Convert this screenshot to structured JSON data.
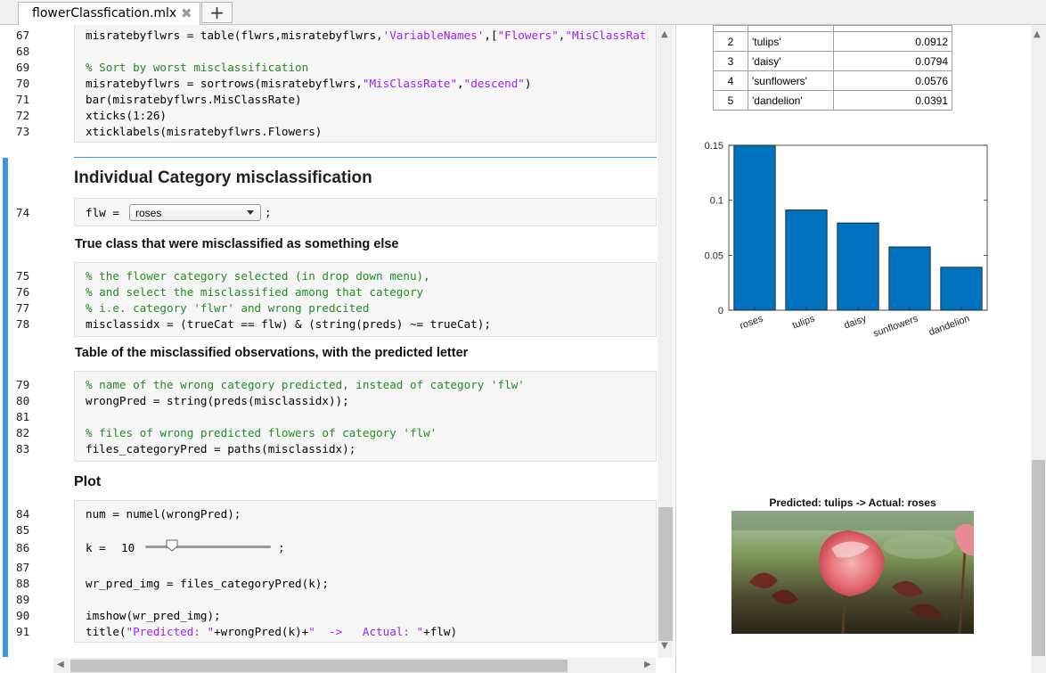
{
  "tabs": {
    "file_label": "flowerClassfication.mlx",
    "close_glyph": "✖",
    "add_glyph": "+"
  },
  "code1": {
    "lines": [
      {
        "n": "67",
        "t": "misratebyflwrs = table(flwrs,misratebyflwrs,'VariableNames',[\"Flowers\",\"MisClassRat"
      },
      {
        "n": "68",
        "t": ""
      },
      {
        "n": "69",
        "t": "% Sort by worst misclassification"
      },
      {
        "n": "70",
        "t": "misratebyflwrs = sortrows(misratebyflwrs,\"MisClassRate\",\"descend\")"
      },
      {
        "n": "71",
        "t": "bar(misratebyflwrs.MisClassRate)"
      },
      {
        "n": "72",
        "t": "xticks(1:26)"
      },
      {
        "n": "73",
        "t": "xticklabels(misratebyflwrs.Flowers)"
      }
    ]
  },
  "section1": {
    "heading": "Individual Category misclassification"
  },
  "line74": {
    "n": "74",
    "prefix": "flw = ",
    "dropdown_value": "roses",
    "suffix": ";"
  },
  "text1": "True class that were misclassified as something else",
  "code2": {
    "c1": "% the flower category selected (in drop down menu),",
    "c2": "% and select the misclassified among that category",
    "c3": "% i.e. category 'flwr' and wrong predcited",
    "c4": "misclassidx = (trueCat == flw) & (string(preds) ~= trueCat);",
    "n": [
      "75",
      "76",
      "77",
      "78"
    ]
  },
  "text2": "Table of the misclassified observations, with the predicted letter",
  "code3": {
    "c1": "% name of the wrong category predicted, instead of category 'flw'",
    "c2": "wrongPred = string(preds(misclassidx));",
    "c4": "% files of wrong predicted flowers of category 'flw'",
    "c5": "files_categoryPred = paths(misclassidx);",
    "n": [
      "79",
      "80",
      "81",
      "82",
      "83"
    ]
  },
  "section2": {
    "heading": "Plot"
  },
  "code4": {
    "c1": "num = numel(wrongPred);",
    "k_label": "k = ",
    "k_value": "10",
    "k_suffix": ";",
    "slider_fraction": 0.21,
    "c5": "wr_pred_img = files_categoryPred(k);",
    "c7": "imshow(wr_pred_img);",
    "c8a": "title(",
    "c8b": "\"Predicted: \"",
    "c8c": "+wrongPred(k)+",
    "c8d": "\"  ->   Actual: \"",
    "c8e": "+flw)",
    "n": [
      "84",
      "85",
      "86",
      "87",
      "88",
      "89",
      "90",
      "91"
    ]
  },
  "output_table": {
    "rows": [
      {
        "idx": "2",
        "name": "'tulips'",
        "val": "0.0912"
      },
      {
        "idx": "3",
        "name": "'daisy'",
        "val": "0.0794"
      },
      {
        "idx": "4",
        "name": "'sunflowers'",
        "val": "0.0576"
      },
      {
        "idx": "5",
        "name": "'dandelion'",
        "val": "0.0391"
      }
    ]
  },
  "chart_data": {
    "type": "bar",
    "categories": [
      "roses",
      "tulips",
      "daisy",
      "sunflowers",
      "dandelion"
    ],
    "values": [
      0.155,
      0.0912,
      0.0794,
      0.0576,
      0.0391
    ],
    "ylim": [
      0,
      0.15
    ],
    "yticks": [
      0,
      0.05,
      0.1,
      0.15
    ],
    "ytick_labels": [
      "0",
      "0.05",
      "0.1",
      "0.15"
    ],
    "bar_color": "#0072bd",
    "title": "",
    "xlabel": "",
    "ylabel": ""
  },
  "image_output": {
    "title": "Predicted: tulips  ->   Actual: roses"
  },
  "colors": {
    "comment": "#228b22",
    "string": "#a020f0",
    "accent": "#3d97e0"
  }
}
